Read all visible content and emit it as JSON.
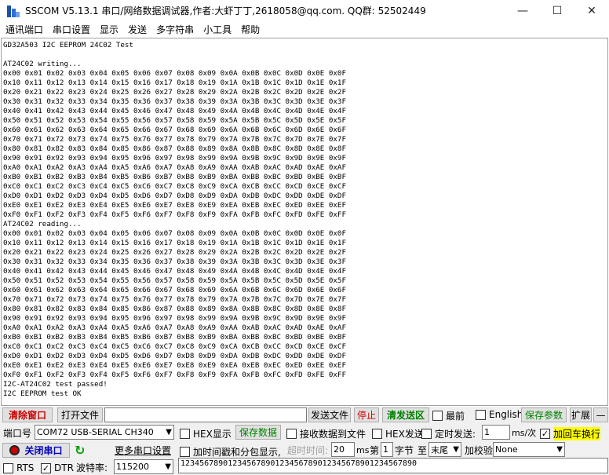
{
  "window": {
    "title": "SSCOM V5.13.1 串口/网络数据调试器,作者:大虾丁丁,2618058@qq.com. QQ群: 52502449",
    "minimize_glyph": "—",
    "maximize_glyph": "☐",
    "close_glyph": "✕"
  },
  "menu": [
    "通讯端口",
    "串口设置",
    "显示",
    "发送",
    "多字符串",
    "小工具",
    "帮助"
  ],
  "output_lines": [
    "GD32A503 I2C EEPROM 24C02 Test",
    "",
    "AT24C02 writing...",
    "0x00 0x01 0x02 0x03 0x04 0x05 0x06 0x07 0x08 0x09 0x0A 0x0B 0x0C 0x0D 0x0E 0x0F",
    "0x10 0x11 0x12 0x13 0x14 0x15 0x16 0x17 0x18 0x19 0x1A 0x1B 0x1C 0x1D 0x1E 0x1F",
    "0x20 0x21 0x22 0x23 0x24 0x25 0x26 0x27 0x28 0x29 0x2A 0x2B 0x2C 0x2D 0x2E 0x2F",
    "0x30 0x31 0x32 0x33 0x34 0x35 0x36 0x37 0x38 0x39 0x3A 0x3B 0x3C 0x3D 0x3E 0x3F",
    "0x40 0x41 0x42 0x43 0x44 0x45 0x46 0x47 0x48 0x49 0x4A 0x4B 0x4C 0x4D 0x4E 0x4F",
    "0x50 0x51 0x52 0x53 0x54 0x55 0x56 0x57 0x58 0x59 0x5A 0x5B 0x5C 0x5D 0x5E 0x5F",
    "0x60 0x61 0x62 0x63 0x64 0x65 0x66 0x67 0x68 0x69 0x6A 0x6B 0x6C 0x6D 0x6E 0x6F",
    "0x70 0x71 0x72 0x73 0x74 0x75 0x76 0x77 0x78 0x79 0x7A 0x7B 0x7C 0x7D 0x7E 0x7F",
    "0x80 0x81 0x82 0x83 0x84 0x85 0x86 0x87 0x88 0x89 0x8A 0x8B 0x8C 0x8D 0x8E 0x8F",
    "0x90 0x91 0x92 0x93 0x94 0x95 0x96 0x97 0x98 0x99 0x9A 0x9B 0x9C 0x9D 0x9E 0x9F",
    "0xA0 0xA1 0xA2 0xA3 0xA4 0xA5 0xA6 0xA7 0xA8 0xA9 0xAA 0xAB 0xAC 0xAD 0xAE 0xAF",
    "0xB0 0xB1 0xB2 0xB3 0xB4 0xB5 0xB6 0xB7 0xB8 0xB9 0xBA 0xBB 0xBC 0xBD 0xBE 0xBF",
    "0xC0 0xC1 0xC2 0xC3 0xC4 0xC5 0xC6 0xC7 0xC8 0xC9 0xCA 0xCB 0xCC 0xCD 0xCE 0xCF",
    "0xD0 0xD1 0xD2 0xD3 0xD4 0xD5 0xD6 0xD7 0xD8 0xD9 0xDA 0xDB 0xDC 0xDD 0xDE 0xDF",
    "0xE0 0xE1 0xE2 0xE3 0xE4 0xE5 0xE6 0xE7 0xE8 0xE9 0xEA 0xEB 0xEC 0xED 0xEE 0xEF",
    "0xF0 0xF1 0xF2 0xF3 0xF4 0xF5 0xF6 0xF7 0xF8 0xF9 0xFA 0xFB 0xFC 0xFD 0xFE 0xFF",
    "AT24C02 reading...",
    "0x00 0x01 0x02 0x03 0x04 0x05 0x06 0x07 0x08 0x09 0x0A 0x0B 0x0C 0x0D 0x0E 0x0F",
    "0x10 0x11 0x12 0x13 0x14 0x15 0x16 0x17 0x18 0x19 0x1A 0x1B 0x1C 0x1D 0x1E 0x1F",
    "0x20 0x21 0x22 0x23 0x24 0x25 0x26 0x27 0x28 0x29 0x2A 0x2B 0x2C 0x2D 0x2E 0x2F",
    "0x30 0x31 0x32 0x33 0x34 0x35 0x36 0x37 0x38 0x39 0x3A 0x3B 0x3C 0x3D 0x3E 0x3F",
    "0x40 0x41 0x42 0x43 0x44 0x45 0x46 0x47 0x48 0x49 0x4A 0x4B 0x4C 0x4D 0x4E 0x4F",
    "0x50 0x51 0x52 0x53 0x54 0x55 0x56 0x57 0x58 0x59 0x5A 0x5B 0x5C 0x5D 0x5E 0x5F",
    "0x60 0x61 0x62 0x63 0x64 0x65 0x66 0x67 0x68 0x69 0x6A 0x6B 0x6C 0x6D 0x6E 0x6F",
    "0x70 0x71 0x72 0x73 0x74 0x75 0x76 0x77 0x78 0x79 0x7A 0x7B 0x7C 0x7D 0x7E 0x7F",
    "0x80 0x81 0x82 0x83 0x84 0x85 0x86 0x87 0x88 0x89 0x8A 0x8B 0x8C 0x8D 0x8E 0x8F",
    "0x90 0x91 0x92 0x93 0x94 0x95 0x96 0x97 0x98 0x99 0x9A 0x9B 0x9C 0x9D 0x9E 0x9F",
    "0xA0 0xA1 0xA2 0xA3 0xA4 0xA5 0xA6 0xA7 0xA8 0xA9 0xAA 0xAB 0xAC 0xAD 0xAE 0xAF",
    "0xB0 0xB1 0xB2 0xB3 0xB4 0xB5 0xB6 0xB7 0xB8 0xB9 0xBA 0xBB 0xBC 0xBD 0xBE 0xBF",
    "0xC0 0xC1 0xC2 0xC3 0xC4 0xC5 0xC6 0xC7 0xC8 0xC9 0xCA 0xCB 0xCC 0xCD 0xCE 0xCF",
    "0xD0 0xD1 0xD2 0xD3 0xD4 0xD5 0xD6 0xD7 0xD8 0xD9 0xDA 0xDB 0xDC 0xDD 0xDE 0xDF",
    "0xE0 0xE1 0xE2 0xE3 0xE4 0xE5 0xE6 0xE7 0xE8 0xE9 0xEA 0xEB 0xEC 0xED 0xEE 0xEF",
    "0xF0 0xF1 0xF2 0xF3 0xF4 0xF5 0xF6 0xF7 0xF8 0xF9 0xFA 0xFB 0xFC 0xFD 0xFE 0xFF",
    "I2C-AT24C02 test passed!",
    "I2C EEPROM test OK"
  ],
  "toolbar": {
    "clear_window": "清除窗口",
    "open_file": "打开文件",
    "file_path": "",
    "send_file": "发送文件",
    "stop": "停止",
    "clear_send": "清发送区",
    "topmost": "最前",
    "english": "English",
    "save_params": "保存参数",
    "expand": "扩展",
    "collapse": "—"
  },
  "port": {
    "port_label": "端口号",
    "port_value": "COM72 USB-SERIAL CH340",
    "hex_display": "HEX显示",
    "save_data": "保存数据",
    "recv_to_file": "接收数据到文件",
    "hex_send": "HEX发送",
    "timed_send": "定时发送:",
    "interval": "1",
    "interval_unit": "ms/次",
    "add_crlf": "加回车换行",
    "close_port": "关闭串口",
    "more_settings": "更多串口设置",
    "timestamp_split": "加时间戳和分包显示,",
    "timeout_label": "超时时间:",
    "timeout_value": "20",
    "ms": "ms",
    "nth": "第",
    "byte_index": "1",
    "byte": "字节",
    "to": "至",
    "to_value": "末尾",
    "checksum_label": "加校验",
    "checksum_value": "None",
    "rts": "RTS",
    "dtr": "DTR",
    "baud_label": "波特率:",
    "baud_value": "115200",
    "send_text": "12345678901234567890123456789012345678901234567890",
    "check_glyph": "✓",
    "dropdown_glyph": "▼",
    "refresh_glyph": "↻"
  },
  "colors": {
    "accent_red": "#cc0000",
    "accent_green": "#008000",
    "highlight_yellow": "#ffff00"
  }
}
